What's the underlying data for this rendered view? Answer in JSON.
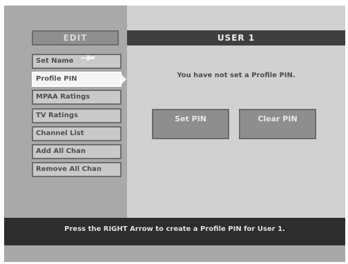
{
  "left_tab": {
    "label": "EDIT"
  },
  "header": {
    "title": "USER 1"
  },
  "menu": {
    "items": [
      {
        "label": "Set Name",
        "selected": false
      },
      {
        "label": "Profile PIN",
        "selected": true
      },
      {
        "label": "MPAA Ratings",
        "selected": false
      },
      {
        "label": "TV Ratings",
        "selected": false
      },
      {
        "label": "Channel List",
        "selected": false
      },
      {
        "label": "Add All Chan",
        "selected": false
      },
      {
        "label": "Remove All Chan",
        "selected": false
      }
    ]
  },
  "main": {
    "message": "You have not set a Profile PIN.",
    "buttons": {
      "set_pin": "Set PIN",
      "clear_pin": "Clear PIN"
    }
  },
  "status": {
    "hint": "Press the RIGHT Arrow to create a Profile PIN for User 1."
  },
  "icons": {
    "pointer": "pointer-cursor-icon",
    "selection_arrow": "right-arrow-icon"
  },
  "colors": {
    "screen_background": "#b9b9b9",
    "left_panel": "#a9a9a9",
    "right_panel": "#d1d1d1",
    "title_bar": "#3f3f3f",
    "status_bar": "#2d2d2d",
    "selected_item": "#f4f4f4",
    "button": "#8e8e8e"
  }
}
